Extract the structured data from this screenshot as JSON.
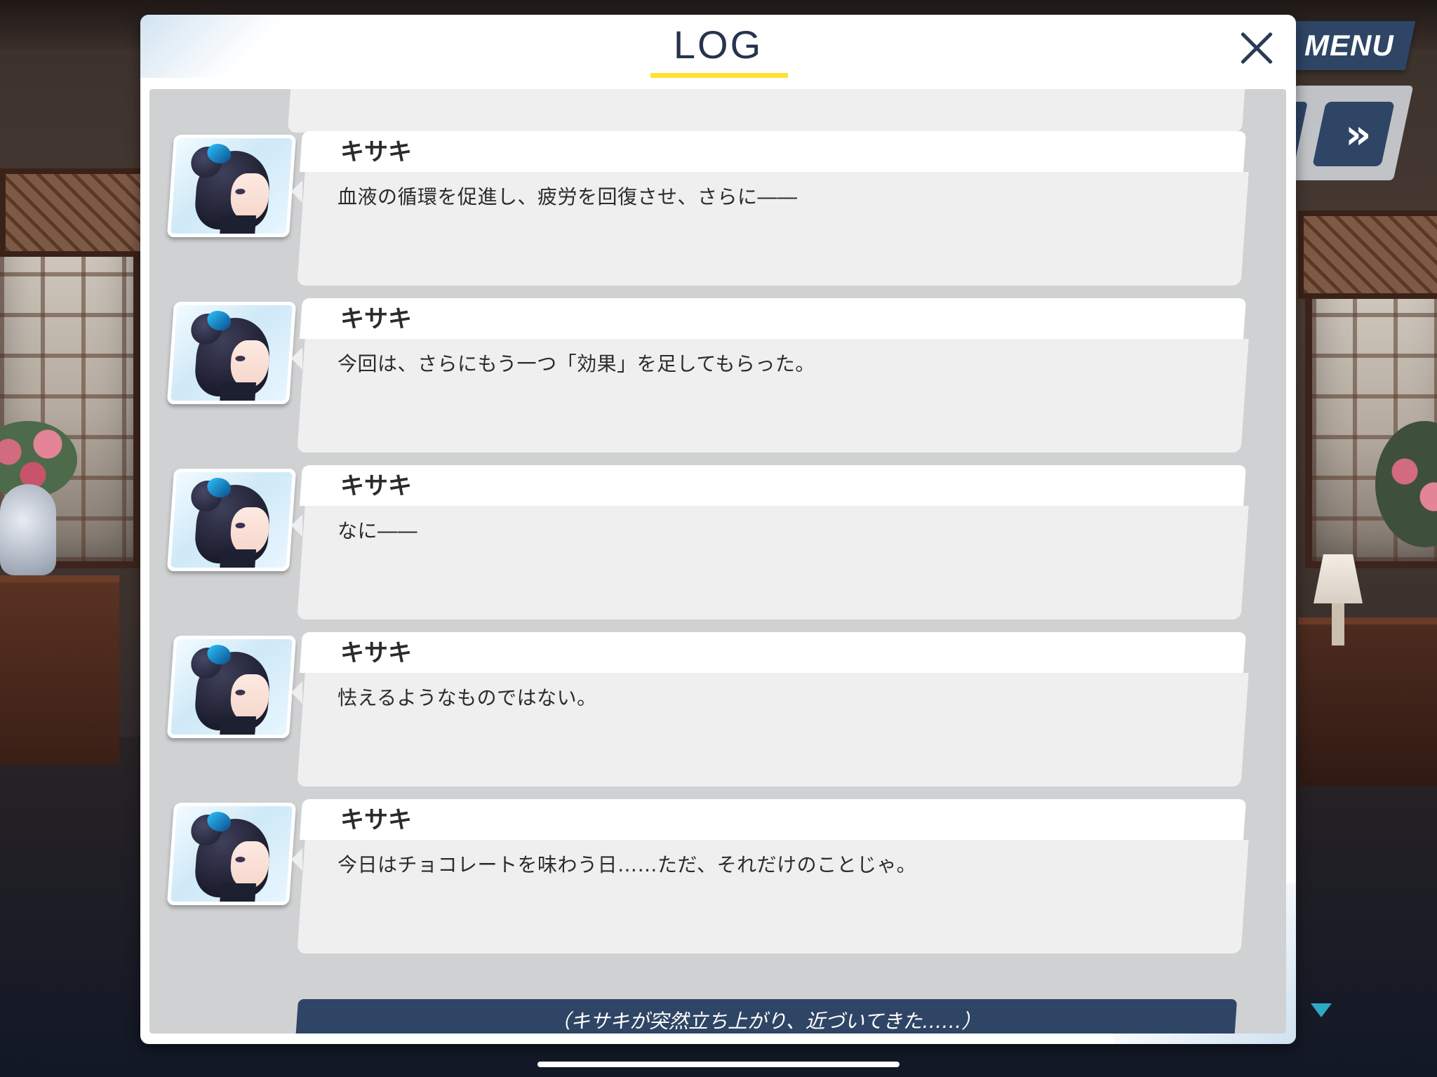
{
  "panel": {
    "title": "LOG"
  },
  "side": {
    "menu_label": "MENU",
    "skip_glyph": "»"
  },
  "log": {
    "entries": [
      {
        "speaker": "キサキ",
        "text": "血液の循環を促進し、疲労を回復させ、さらに――"
      },
      {
        "speaker": "キサキ",
        "text": "今回は、さらにもう一つ「効果」を足してもらった。"
      },
      {
        "speaker": "キサキ",
        "text": "なに――"
      },
      {
        "speaker": "キサキ",
        "text": "怯えるようなものではない。"
      },
      {
        "speaker": "キサキ",
        "text": "今日はチョコレートを味わう日……ただ、それだけのことじゃ。"
      }
    ],
    "narration": "（キサキが突然立ち上がり、近づいてきた……）"
  },
  "icons": {
    "close": "close-icon",
    "scroll": "triangle-down-icon",
    "skip": "fast-forward-icon"
  },
  "colors": {
    "accent_underline": "#ffe234",
    "navy_button": "#2e4566",
    "narration_bg": "#2f4565"
  }
}
